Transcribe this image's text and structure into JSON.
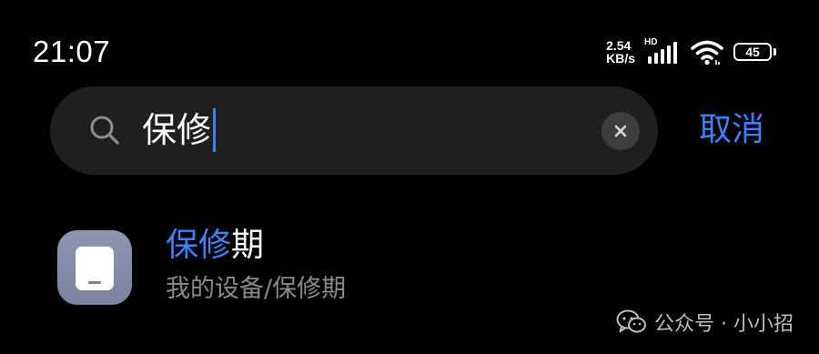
{
  "status_bar": {
    "time": "21:07",
    "net_speed_value": "2.54",
    "net_speed_unit": "KB/s",
    "network_badge": "HD",
    "battery_level": "45",
    "icons": [
      "signal-icon",
      "wifi-icon",
      "battery-icon"
    ]
  },
  "search": {
    "query": "保修",
    "search_icon": "search-icon",
    "clear_icon": "close-icon",
    "cancel_label": "取消"
  },
  "results": [
    {
      "title_highlight": "保修",
      "title_rest": "期",
      "path": "我的设备/保修期",
      "icon": "device-icon"
    }
  ],
  "watermark": {
    "text": "公众号 · 小小招",
    "icon": "wechat-icon"
  },
  "colors": {
    "background": "#000000",
    "search_field": "#1f1f1f",
    "accent": "#3a82f7",
    "secondary_text": "#8a8a8a"
  }
}
